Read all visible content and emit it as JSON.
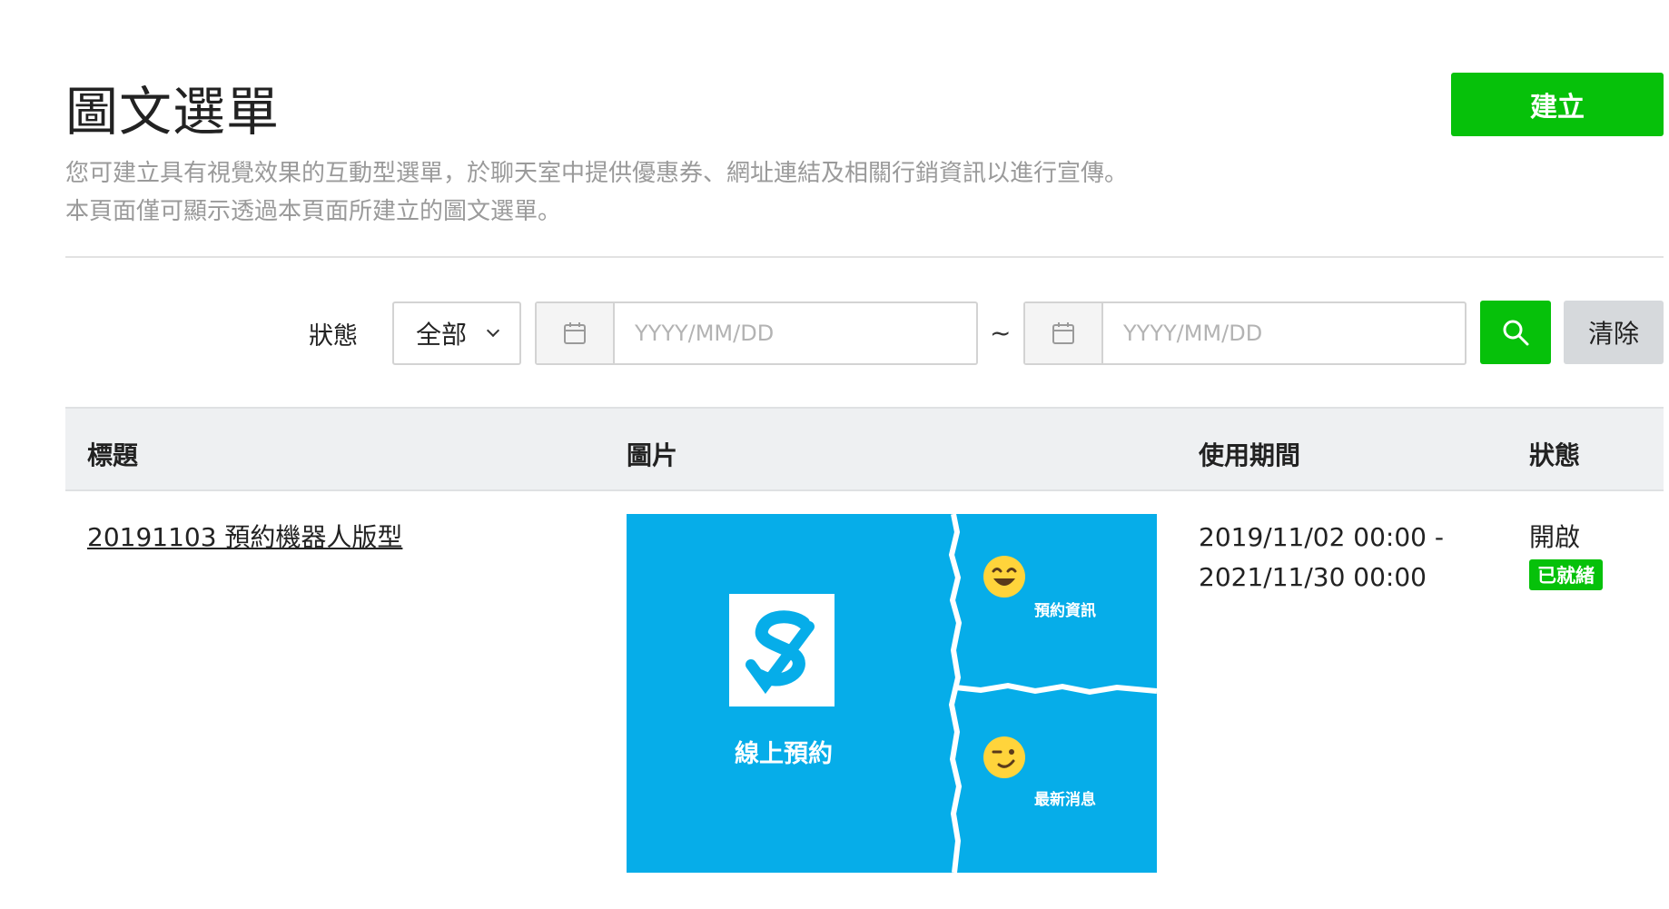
{
  "header": {
    "title": "圖文選單",
    "create_label": "建立",
    "description_line1": "您可建立具有視覺效果的互動型選單，於聊天室中提供優惠券、網址連結及相關行銷資訊以進行宣傳。",
    "description_line2": "本頁面僅可顯示透過本頁面所建立的圖文選單。"
  },
  "filter": {
    "status_label": "狀態",
    "status_value": "全部",
    "date_from_placeholder": "YYYY/MM/DD",
    "date_to_placeholder": "YYYY/MM/DD",
    "range_separator": "~",
    "clear_label": "清除"
  },
  "table": {
    "columns": [
      "標題",
      "圖片",
      "使用期間",
      "狀態"
    ],
    "rows": [
      {
        "title": "20191103 預約機器人版型",
        "period_start": "2019/11/02 00:00 -",
        "period_end": "2021/11/30 00:00",
        "status": "開啟",
        "badge": "已就緒",
        "image": {
          "main_label": "線上預約",
          "area1_label": "預約資訊",
          "area2_label": "最新消息"
        }
      }
    ]
  },
  "colors": {
    "accent_green": "#06c10a",
    "image_blue": "#06ade9",
    "header_bg": "#eef0f2"
  }
}
